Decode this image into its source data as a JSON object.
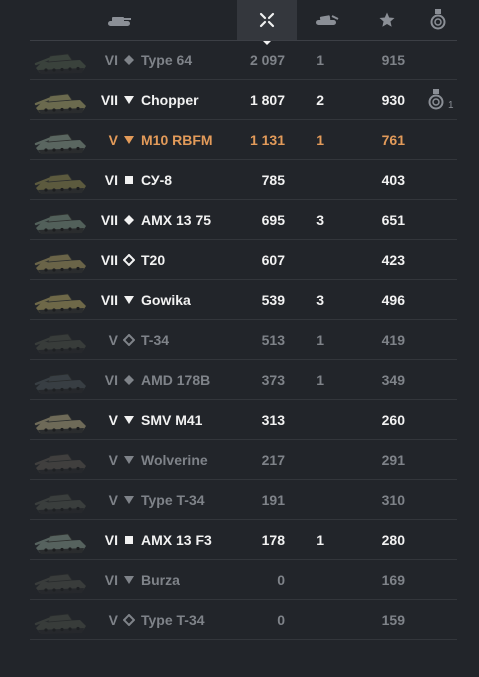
{
  "header": {
    "columns": [
      {
        "icon": "tank-icon",
        "active": false
      },
      {
        "icon": "crossed-swords-icon",
        "active": true
      },
      {
        "icon": "destroyed-tank-icon",
        "active": false
      },
      {
        "icon": "star-icon",
        "active": false
      },
      {
        "icon": "medal-icon",
        "active": false
      }
    ]
  },
  "colors": {
    "background": "#22252a",
    "highlight": "#e39b5a",
    "dim": "#7f8389",
    "bright": "#f2f2f2"
  },
  "rows": [
    {
      "tier": "VI",
      "class": "medium-tank-icon",
      "name": "Type 64",
      "damage": "2 097",
      "kills": "1",
      "xp": "915",
      "style": "dim",
      "medal_count": ""
    },
    {
      "tier": "VII",
      "class": "tank-destroyer-icon",
      "name": "Chopper",
      "damage": "1 807",
      "kills": "2",
      "xp": "930",
      "style": "bright",
      "medal_count": "1"
    },
    {
      "tier": "V",
      "class": "tank-destroyer-icon",
      "name": "M10 RBFM",
      "damage": "1 131",
      "kills": "1",
      "xp": "761",
      "style": "highlight",
      "medal_count": ""
    },
    {
      "tier": "VI",
      "class": "heavy-tank-icon",
      "name": "СУ-8",
      "damage": "785",
      "kills": "",
      "xp": "403",
      "style": "bright",
      "medal_count": ""
    },
    {
      "tier": "VII",
      "class": "medium-tank-icon",
      "name": "AMX 13 75",
      "damage": "695",
      "kills": "3",
      "xp": "651",
      "style": "bright",
      "medal_count": ""
    },
    {
      "tier": "VII",
      "class": "light-tank-icon",
      "name": "T20",
      "damage": "607",
      "kills": "",
      "xp": "423",
      "style": "bright",
      "medal_count": ""
    },
    {
      "tier": "VII",
      "class": "tank-destroyer-icon",
      "name": "Gowika",
      "damage": "539",
      "kills": "3",
      "xp": "496",
      "style": "bright",
      "medal_count": ""
    },
    {
      "tier": "V",
      "class": "light-tank-icon",
      "name": "T-34",
      "damage": "513",
      "kills": "1",
      "xp": "419",
      "style": "dim",
      "medal_count": ""
    },
    {
      "tier": "VI",
      "class": "medium-tank-icon",
      "name": "AMD 178B",
      "damage": "373",
      "kills": "1",
      "xp": "349",
      "style": "dim",
      "medal_count": ""
    },
    {
      "tier": "V",
      "class": "tank-destroyer-icon",
      "name": "SMV M41",
      "damage": "313",
      "kills": "",
      "xp": "260",
      "style": "bright",
      "medal_count": ""
    },
    {
      "tier": "V",
      "class": "tank-destroyer-icon",
      "name": "Wolverine",
      "damage": "217",
      "kills": "",
      "xp": "291",
      "style": "dim",
      "medal_count": ""
    },
    {
      "tier": "V",
      "class": "tank-destroyer-icon",
      "name": "Type T-34",
      "damage": "191",
      "kills": "",
      "xp": "310",
      "style": "dim",
      "medal_count": ""
    },
    {
      "tier": "VI",
      "class": "heavy-tank-icon",
      "name": "AMX 13 F3",
      "damage": "178",
      "kills": "1",
      "xp": "280",
      "style": "bright",
      "medal_count": ""
    },
    {
      "tier": "VI",
      "class": "tank-destroyer-icon",
      "name": "Burza",
      "damage": "0",
      "kills": "",
      "xp": "169",
      "style": "dim",
      "medal_count": ""
    },
    {
      "tier": "V",
      "class": "light-tank-icon",
      "name": "Type T-34",
      "damage": "0",
      "kills": "",
      "xp": "159",
      "style": "dim",
      "medal_count": ""
    }
  ]
}
